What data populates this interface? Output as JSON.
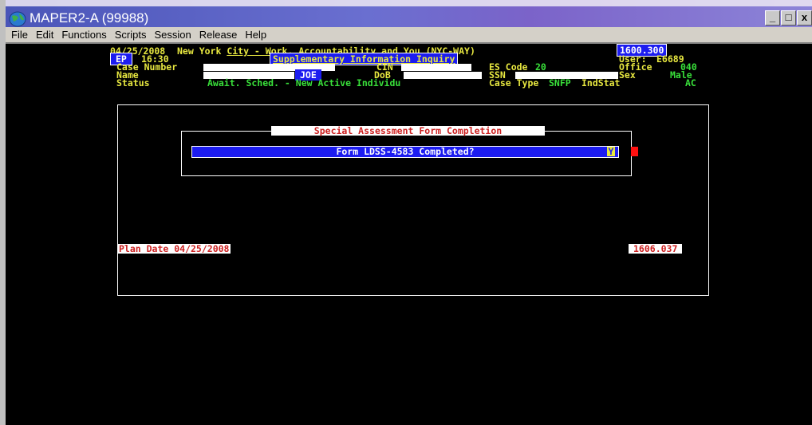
{
  "window": {
    "title": "MAPER2-A (99988)",
    "controls": [
      "_",
      "□",
      "x"
    ]
  },
  "menu": [
    "File",
    "Edit",
    "Functions",
    "Scripts",
    "Session",
    "Release",
    "Help"
  ],
  "header": {
    "date": "04/25/2008",
    "system_name_prefix": "New York ",
    "system_name_link": "City - Work, Accountability and You",
    "system_name_suffix": " (NYC-WAY)",
    "screen_id": "1600.300",
    "mode": "EP",
    "time": "16:30",
    "screen_title": "Supplementary Information Inquiry",
    "user_label": "User:",
    "user_value": "E6689"
  },
  "fields": {
    "case_number_label": "Case Number",
    "cin_label": "CIN",
    "es_code_label": "ES Code",
    "es_code_value": "20",
    "office_label": "Office",
    "office_value": "040",
    "name_label": "Name",
    "name_value": "JOE",
    "dob_label": "DoB",
    "ssn_label": "SSN",
    "sex_label": "Sex",
    "sex_value": "Male",
    "status_label": "Status",
    "status_value": "Await. Sched. - New Active Individu",
    "case_type_label": "Case Type",
    "case_type_value": "SNFP",
    "indstat_label": "IndStat",
    "indstat_value": "AC"
  },
  "dialog": {
    "title": "Special Assessment Form Completion",
    "question": "Form LDSS-4583 Completed?",
    "answer": "Y"
  },
  "footer": {
    "plan_date": "Plan Date 04/25/2008",
    "screen_code": "1606.037"
  },
  "colors": {
    "terminal_bg": "#000000",
    "label_yellow": "#e8e840",
    "value_green": "#39e03a",
    "highlight_blue": "#1c1cf0",
    "alert_red": "#ff3030"
  }
}
